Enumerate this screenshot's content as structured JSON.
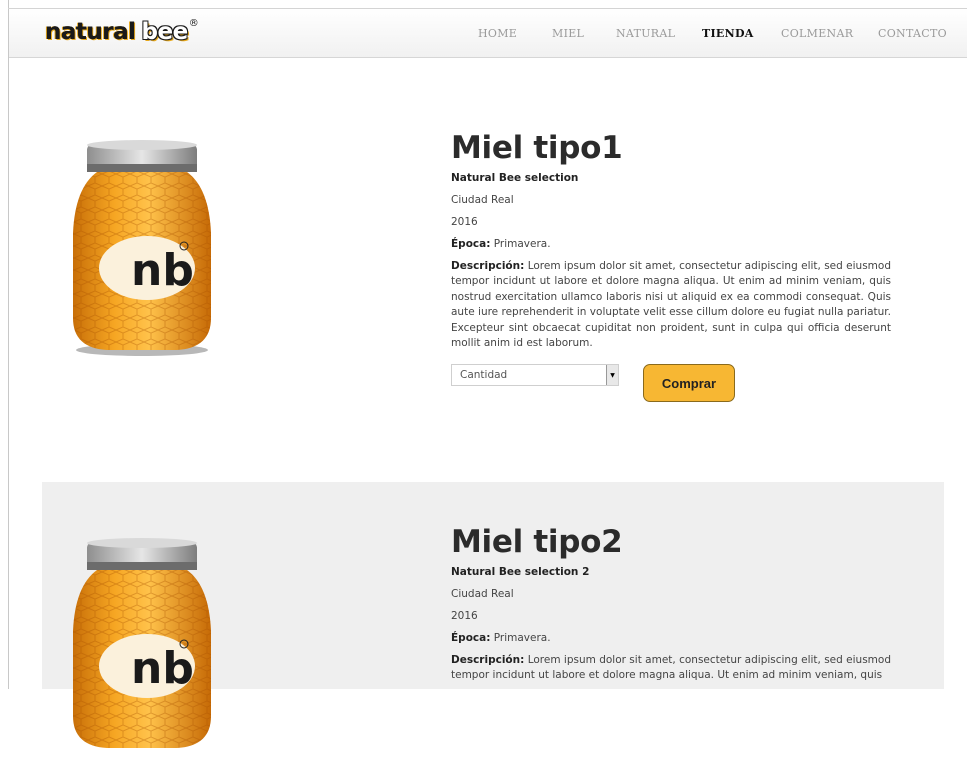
{
  "brand": {
    "word1": "natural",
    "word2": "bee",
    "reg": "®"
  },
  "nav": {
    "items": [
      {
        "label": "HOME"
      },
      {
        "label": "MIEL"
      },
      {
        "label": "NATURAL"
      },
      {
        "label": "TIENDA"
      },
      {
        "label": "COLMENAR"
      },
      {
        "label": "CONTACTO"
      }
    ],
    "active": "TIENDA"
  },
  "products": [
    {
      "title": "Miel tipo1",
      "subtitle": "Natural Bee selection",
      "city": "Ciudad Real",
      "year": "2016",
      "epoca_label": "Época:",
      "epoca_value": "Primavera.",
      "desc_label": "Descripción:",
      "desc_text": "Lorem ipsum dolor sit amet, consectetur adipiscing elit, sed eiusmod tempor incidunt ut labore et dolore magna aliqua. Ut enim ad minim veniam, quis nostrud exercitation ullamco laboris nisi ut aliquid ex ea commodi consequat. Quis aute iure reprehenderit in voluptate velit esse cillum dolore eu fugiat nulla pariatur. Excepteur sint obcaecat cupiditat non proident, sunt in culpa qui officia deserunt mollit anim id est laborum.",
      "quantity_placeholder": "Cantidad",
      "buy_label": "Comprar",
      "jar_label": "nb"
    },
    {
      "title": "Miel tipo2",
      "subtitle": "Natural Bee selection 2",
      "city": "Ciudad Real",
      "year": "2016",
      "epoca_label": "Época:",
      "epoca_value": "Primavera.",
      "desc_label": "Descripción:",
      "desc_text": "Lorem ipsum dolor sit amet, consectetur adipiscing elit, sed eiusmod tempor incidunt ut labore et dolore magna aliqua. Ut enim ad minim veniam, quis",
      "jar_label": "nb"
    }
  ],
  "colors": {
    "accent": "#f7b733",
    "honey": "#f0a21c",
    "lid": "#b8b8b8",
    "alt_bg": "#efefef"
  }
}
